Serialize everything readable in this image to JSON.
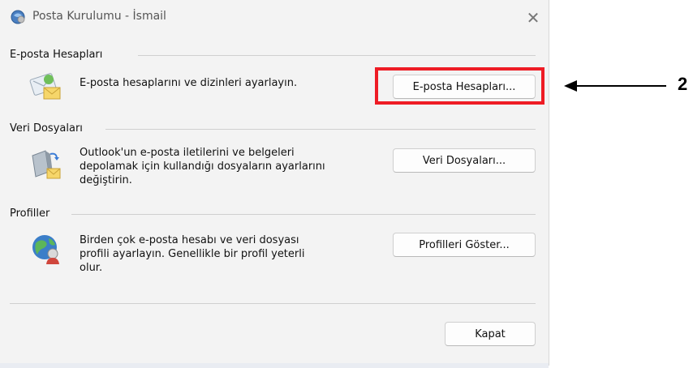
{
  "window": {
    "title": "Posta Kurulumu - İsmail",
    "close_glyph": "✕"
  },
  "sections": {
    "email": {
      "label": "E-posta Hesapları",
      "description": "E-posta hesaplarını ve dizinleri ayarlayın.",
      "button_label": "E-posta Hesapları...",
      "icon": "email-accounts-icon"
    },
    "data_files": {
      "label": "Veri Dosyaları",
      "description_lines": [
        "Outlook'un e-posta iletilerini ve belgeleri",
        "depolamak için kullandığı dosyaların ayarlarını",
        "değiştirin."
      ],
      "button_label": "Veri Dosyaları...",
      "icon": "data-files-icon"
    },
    "profiles": {
      "label": "Profiller",
      "description_lines": [
        "Birden çok e-posta hesabı ve veri dosyası",
        "profili ayarlayın. Genellikle bir profil yeterli",
        "olur."
      ],
      "button_label": "Profilleri Göster...",
      "icon": "profiles-icon"
    }
  },
  "footer": {
    "close_label": "Kapat"
  },
  "annotation": {
    "number": "2",
    "highlight_color": "#ee1c25"
  }
}
